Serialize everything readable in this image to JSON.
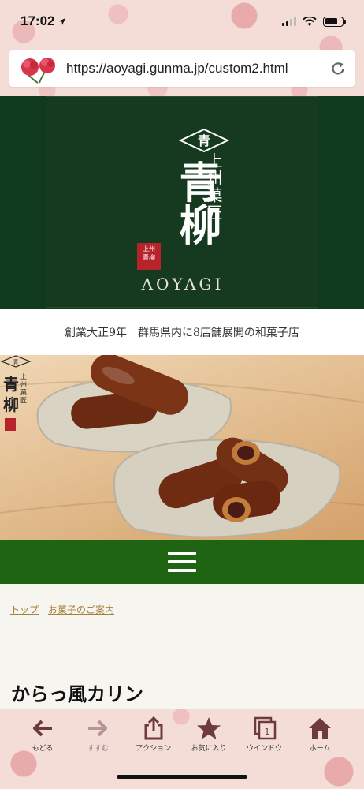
{
  "status_bar": {
    "time": "17:02",
    "battery_level": 0.75
  },
  "browser": {
    "url": "https://aoyagi.gunma.jp/custom2.html"
  },
  "header": {
    "logo_main": "青柳",
    "logo_sub": "上州菓匠",
    "logo_en": "AOYAGI",
    "tagline": "創業大正9年　群馬県内に8店舗展開の和菓子店"
  },
  "breadcrumb": {
    "items": [
      "トップ",
      "お菓子のご案内"
    ]
  },
  "page": {
    "heading": "からっ風カリン"
  },
  "toolbar": {
    "back_label": "もどる",
    "forward_label": "すすむ",
    "action_label": "アクション",
    "favorites_label": "お気に入り",
    "window_label": "ウインドウ",
    "window_count": "1",
    "home_label": "ホーム"
  },
  "colors": {
    "header_green": "#153a20",
    "nav_green": "#1f6412",
    "link_gold": "#a5823a",
    "toolbar_icon": "#6d3b3b"
  }
}
